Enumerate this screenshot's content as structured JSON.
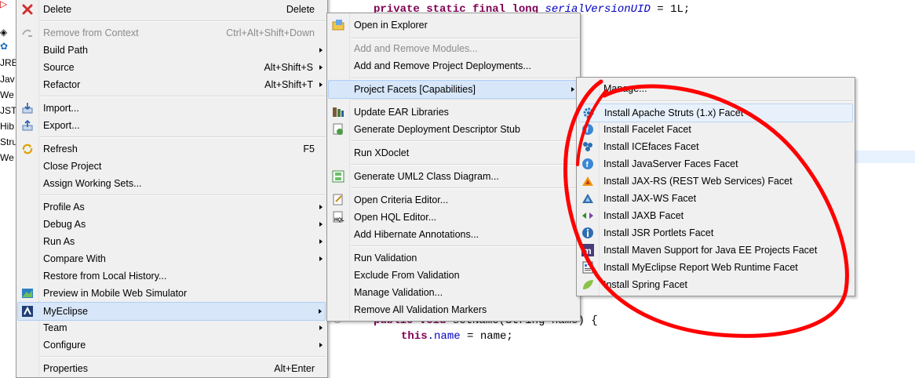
{
  "editor": {
    "left_labels": [
      "JRE",
      "Jav",
      "We",
      "JST",
      "Hib",
      "Stru",
      "We"
    ],
    "code_lines": [
      {
        "kw1": "private static final long ",
        "name": "serialVersionUID",
        "rest": " = 1L;"
      },
      {
        "kw1": "public void ",
        "rest": "setName(String name) {"
      },
      {
        "kw1": "this",
        "fld": ".name",
        "rest": " = name;"
      }
    ]
  },
  "context_menu": {
    "items": [
      {
        "label": "Delete",
        "accel": "Delete",
        "icon": "delete-icon"
      },
      {
        "label": "Remove from Context",
        "accel": "Ctrl+Alt+Shift+Down",
        "icon": "remove-context-icon",
        "disabled": true
      },
      {
        "label": "Build Path",
        "submenu": true
      },
      {
        "label": "Source",
        "accel": "Alt+Shift+S",
        "submenu": true
      },
      {
        "label": "Refactor",
        "accel": "Alt+Shift+T",
        "submenu": true
      },
      {
        "label": "Import...",
        "icon": "import-icon"
      },
      {
        "label": "Export...",
        "icon": "export-icon"
      },
      {
        "label": "Refresh",
        "accel": "F5",
        "icon": "refresh-icon"
      },
      {
        "label": "Close Project"
      },
      {
        "label": "Assign Working Sets..."
      },
      {
        "label": "Profile As",
        "submenu": true
      },
      {
        "label": "Debug As",
        "submenu": true
      },
      {
        "label": "Run As",
        "submenu": true
      },
      {
        "label": "Compare With",
        "submenu": true
      },
      {
        "label": "Restore from Local History..."
      },
      {
        "label": "Preview in Mobile Web Simulator",
        "icon": "mobile-icon"
      },
      {
        "label": "MyEclipse",
        "submenu": true,
        "icon": "myeclipse-icon"
      },
      {
        "label": "Team",
        "submenu": true
      },
      {
        "label": "Configure",
        "submenu": true
      },
      {
        "label": "Properties",
        "accel": "Alt+Enter"
      }
    ]
  },
  "myeclipse_menu": {
    "items": [
      {
        "label": "Open in Explorer",
        "icon": "folder-icon"
      },
      {
        "label": "Add and Remove Modules...",
        "disabled": true
      },
      {
        "label": "Add and Remove Project Deployments..."
      },
      {
        "label": "Project Facets [Capabilities]",
        "submenu": true
      },
      {
        "label": "Update EAR Libraries",
        "icon": "ear-icon"
      },
      {
        "label": "Generate Deployment Descriptor Stub",
        "icon": "descriptor-icon"
      },
      {
        "label": "Run XDoclet"
      },
      {
        "label": "Generate UML2 Class Diagram...",
        "icon": "uml-icon"
      },
      {
        "label": "Open Criteria Editor...",
        "icon": "criteria-icon"
      },
      {
        "label": "Open HQL Editor...",
        "icon": "hql-icon"
      },
      {
        "label": "Add Hibernate Annotations..."
      },
      {
        "label": "Run Validation"
      },
      {
        "label": "Exclude From Validation"
      },
      {
        "label": "Manage Validation..."
      },
      {
        "label": "Remove All Validation Markers"
      }
    ]
  },
  "facets_menu": {
    "items": [
      {
        "label": "Manage..."
      },
      {
        "label": "Install Apache Struts (1.x) Facet",
        "icon": "struts-gear-icon"
      },
      {
        "label": "Install Facelet Facet",
        "icon": "facelet-icon"
      },
      {
        "label": "Install ICEfaces Facet",
        "icon": "icefaces-icon"
      },
      {
        "label": "Install JavaServer Faces Facet",
        "icon": "jsf-icon"
      },
      {
        "label": "Install JAX-RS (REST Web Services) Facet",
        "icon": "jaxrs-icon"
      },
      {
        "label": "Install JAX-WS Facet",
        "icon": "jaxws-icon"
      },
      {
        "label": "Install JAXB Facet",
        "icon": "jaxb-icon"
      },
      {
        "label": "Install JSR Portlets Facet",
        "icon": "portlet-icon"
      },
      {
        "label": "Install Maven Support for Java EE Projects Facet",
        "icon": "maven-icon"
      },
      {
        "label": "Install MyEclipse Report Web Runtime Facet",
        "icon": "report-icon"
      },
      {
        "label": "Install Spring Facet",
        "icon": "spring-leaf-icon"
      }
    ]
  },
  "colors": {
    "annotation": "#ff0000",
    "menu_bg": "#f0f0f0",
    "highlight": "#d7e6f8",
    "keyword": "#7f0055",
    "field": "#0000c0"
  }
}
